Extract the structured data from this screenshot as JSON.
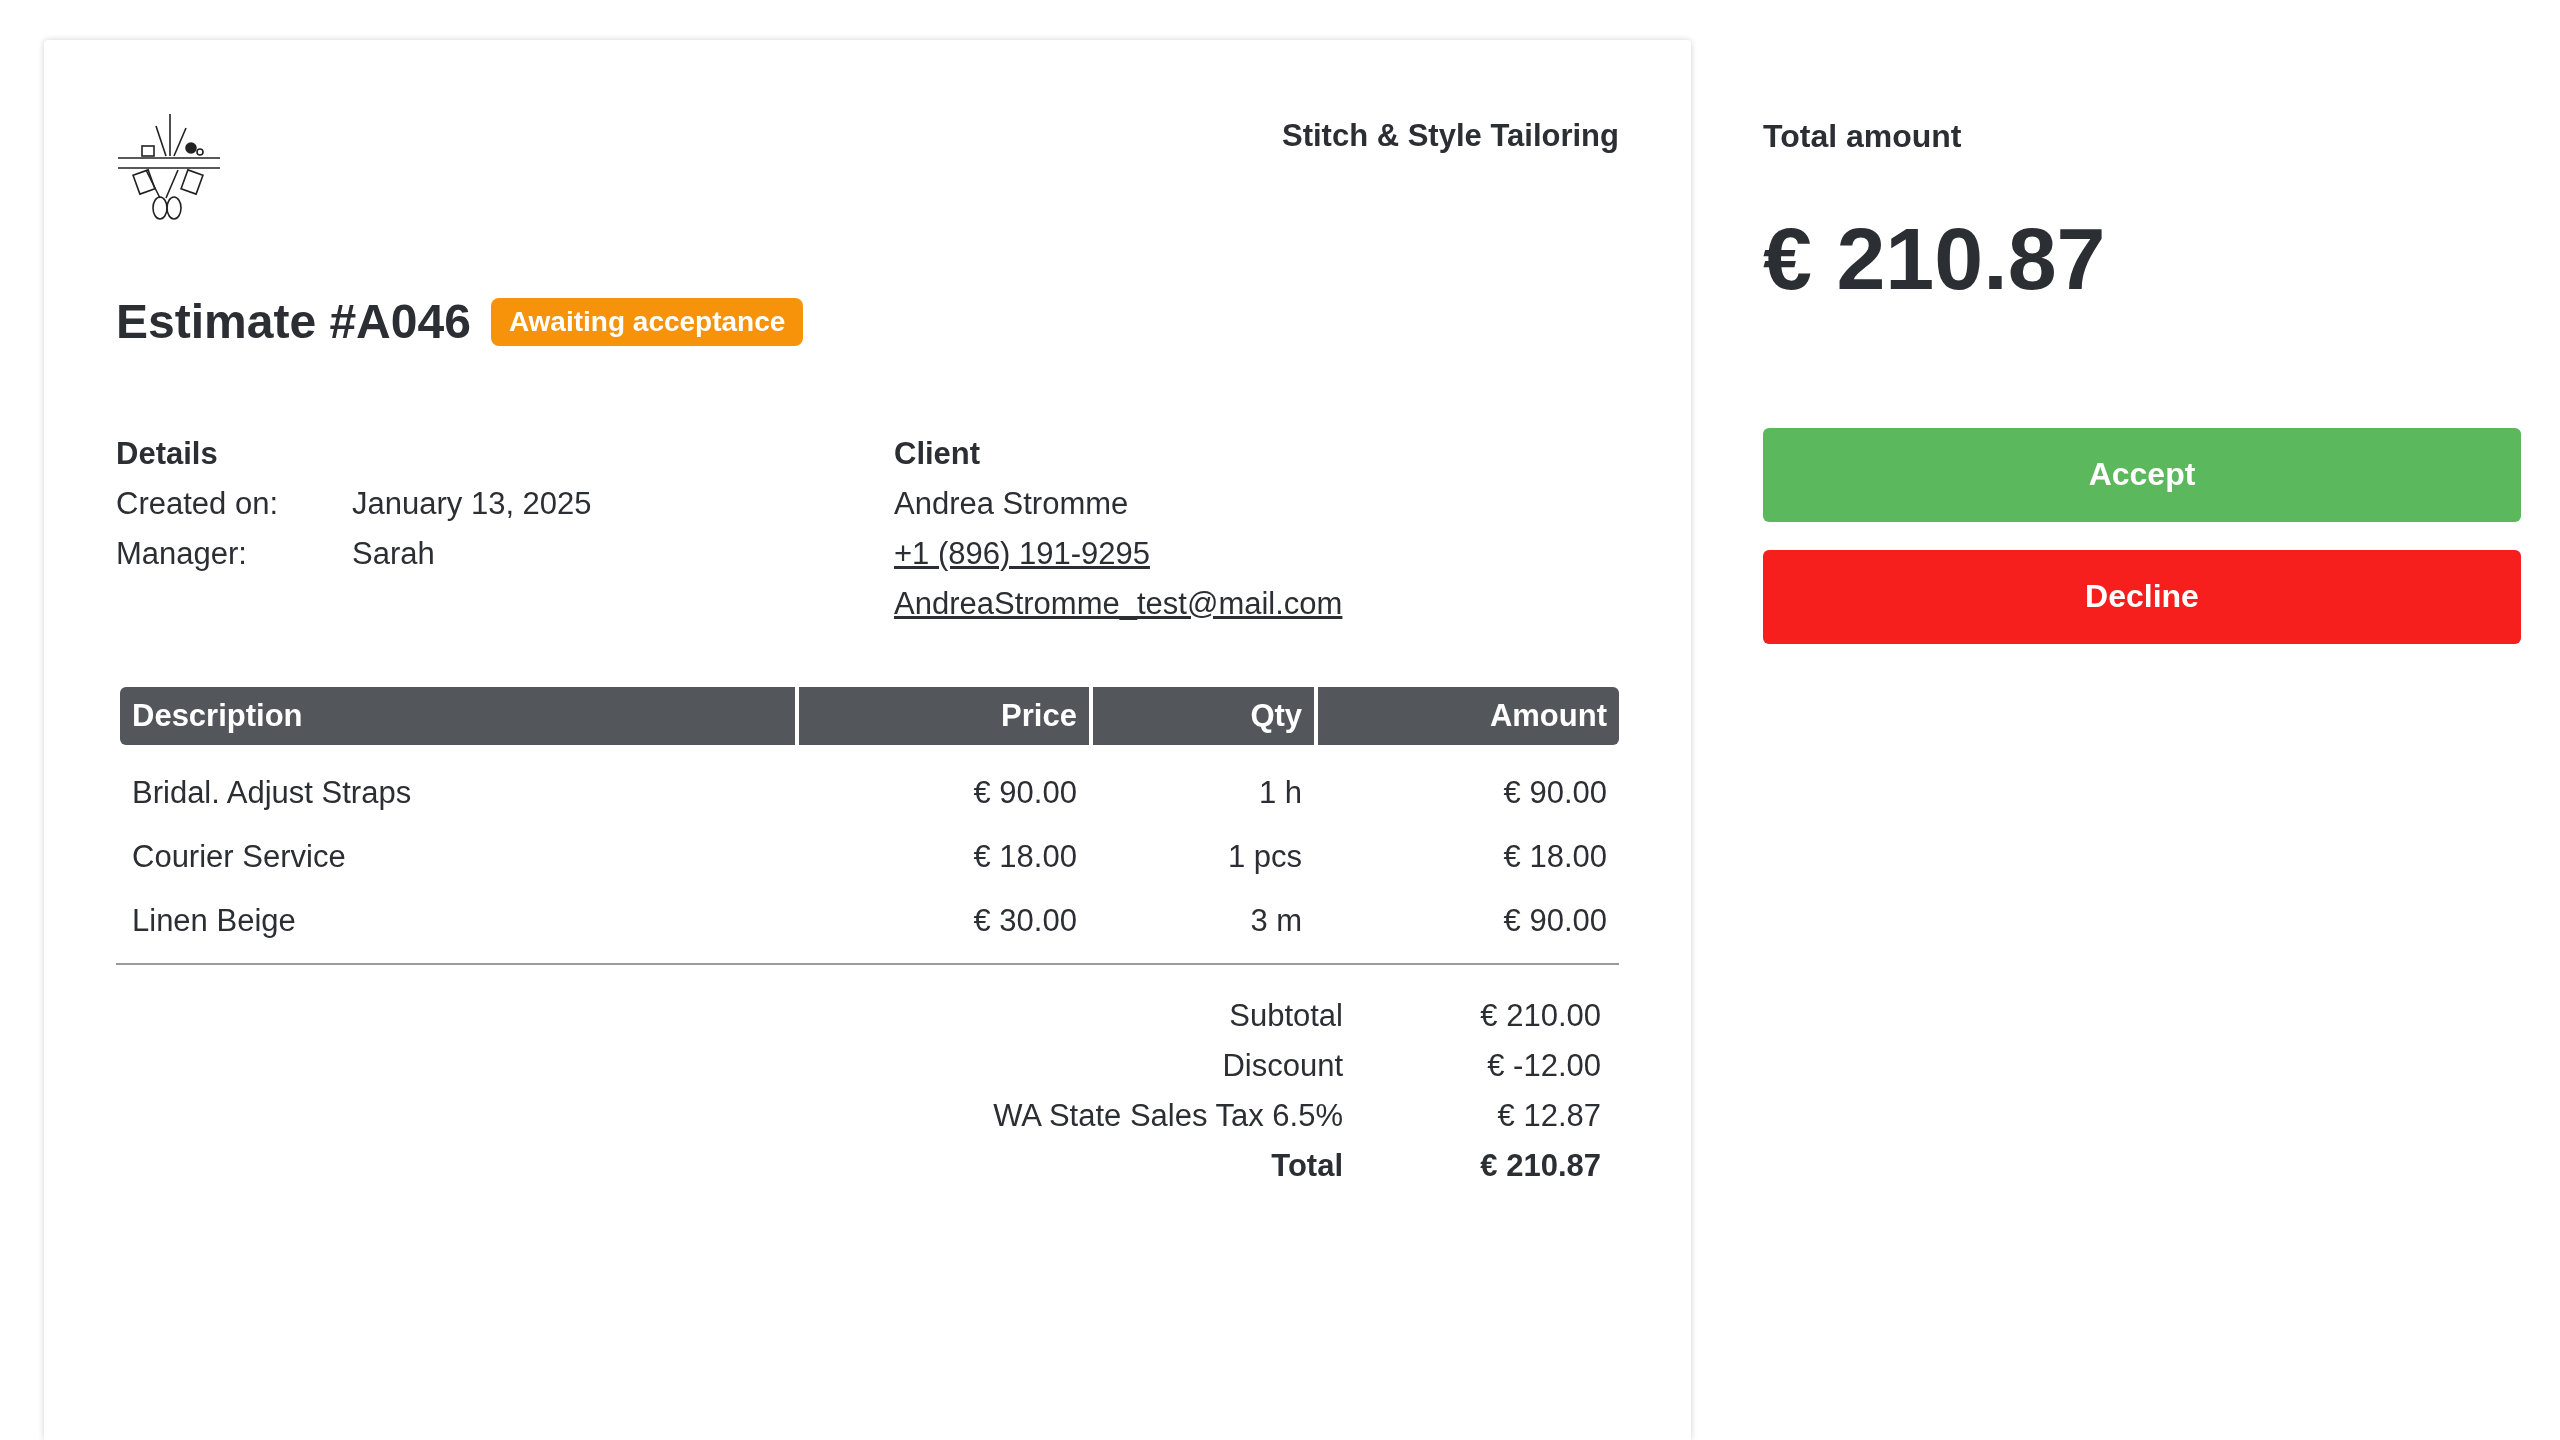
{
  "company": {
    "name": "Stitch & Style Tailoring"
  },
  "estimate": {
    "title": "Estimate #A046",
    "status": {
      "label": "Awaiting acceptance",
      "kind": "awaiting"
    }
  },
  "details": {
    "heading": "Details",
    "rows": [
      {
        "label": "Created on:",
        "value": "January 13, 2025"
      },
      {
        "label": "Manager:",
        "value": "Sarah"
      }
    ]
  },
  "client": {
    "heading": "Client",
    "name": "Andrea Stromme",
    "phone": "+1 (896) 191-9295",
    "email": "AndreaStromme_test@mail.com"
  },
  "table": {
    "columns": [
      "Description",
      "Price",
      "Qty",
      "Amount"
    ],
    "rows": [
      [
        "Bridal. Adjust Straps",
        "€ 90.00",
        "1 h",
        "€ 90.00"
      ],
      [
        "Courier Service",
        "€ 18.00",
        "1 pcs",
        "€ 18.00"
      ],
      [
        "Linen Beige",
        "€ 30.00",
        "3 m",
        "€ 90.00"
      ]
    ]
  },
  "totals": [
    {
      "kind": "line",
      "label": "Subtotal",
      "value": "€ 210.00"
    },
    {
      "kind": "line",
      "label": "Discount",
      "value": "€ -12.00"
    },
    {
      "kind": "line",
      "label": "WA State Sales Tax 6.5%",
      "value": "€ 12.87"
    },
    {
      "kind": "total",
      "label": "Total",
      "value": "€ 210.87"
    }
  ],
  "summary": {
    "heading": "Total amount",
    "amount": "€ 210.87"
  },
  "buttons": [
    {
      "kind": "accept",
      "label": "Accept"
    },
    {
      "kind": "decline",
      "label": "Decline"
    }
  ]
}
